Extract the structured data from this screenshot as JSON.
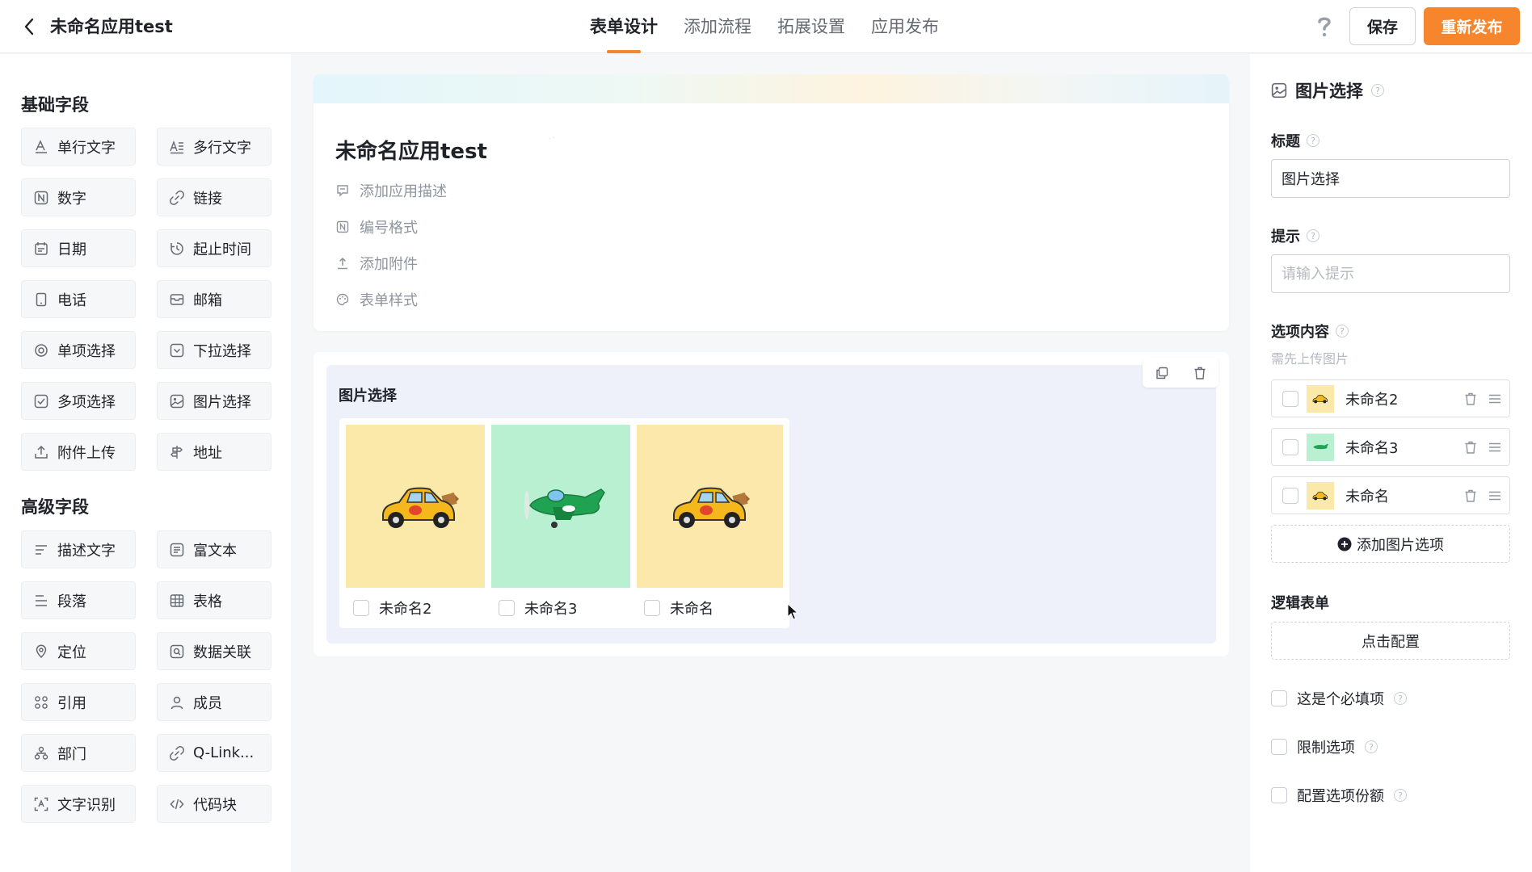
{
  "header": {
    "back_icon": "chevron-left-icon",
    "app_title": "未命名应用test",
    "tabs": [
      {
        "label": "表单设计",
        "active": true
      },
      {
        "label": "添加流程",
        "active": false
      },
      {
        "label": "拓展设置",
        "active": false
      },
      {
        "label": "应用发布",
        "active": false
      }
    ],
    "help_icon": "question-icon",
    "save_label": "保存",
    "publish_label": "重新发布",
    "accent_color": "#f5862e"
  },
  "left_panel": {
    "basic_title": "基础字段",
    "basic_fields": [
      {
        "label": "单行文字",
        "icon": "single-line-text-icon"
      },
      {
        "label": "多行文字",
        "icon": "multi-line-text-icon"
      },
      {
        "label": "数字",
        "icon": "number-icon"
      },
      {
        "label": "链接",
        "icon": "link-icon"
      },
      {
        "label": "日期",
        "icon": "calendar-icon"
      },
      {
        "label": "起止时间",
        "icon": "time-range-icon"
      },
      {
        "label": "电话",
        "icon": "phone-icon"
      },
      {
        "label": "邮箱",
        "icon": "mail-icon"
      },
      {
        "label": "单项选择",
        "icon": "radio-icon"
      },
      {
        "label": "下拉选择",
        "icon": "dropdown-icon"
      },
      {
        "label": "多项选择",
        "icon": "checkbox-icon"
      },
      {
        "label": "图片选择",
        "icon": "image-icon"
      },
      {
        "label": "附件上传",
        "icon": "upload-icon"
      },
      {
        "label": "地址",
        "icon": "location-icon"
      }
    ],
    "advanced_title": "高级字段",
    "advanced_fields": [
      {
        "label": "描述文字",
        "icon": "description-icon"
      },
      {
        "label": "富文本",
        "icon": "rich-text-icon"
      },
      {
        "label": "段落",
        "icon": "paragraph-icon"
      },
      {
        "label": "表格",
        "icon": "table-icon"
      },
      {
        "label": "定位",
        "icon": "pin-icon"
      },
      {
        "label": "数据关联",
        "icon": "data-link-icon"
      },
      {
        "label": "引用",
        "icon": "reference-icon"
      },
      {
        "label": "成员",
        "icon": "user-icon"
      },
      {
        "label": "部门",
        "icon": "org-icon"
      },
      {
        "label": "Q-Link...",
        "icon": "qlink-icon"
      },
      {
        "label": "文字识别",
        "icon": "ocr-icon"
      },
      {
        "label": "代码块",
        "icon": "code-icon"
      }
    ]
  },
  "form": {
    "title": "未命名应用test",
    "options": [
      {
        "label": "添加应用描述",
        "icon": "comment-icon"
      },
      {
        "label": "编号格式",
        "icon": "number-icon"
      },
      {
        "label": "添加附件",
        "icon": "upload-icon"
      },
      {
        "label": "表单样式",
        "icon": "palette-icon"
      }
    ]
  },
  "field_card": {
    "title": "图片选择",
    "copy_icon": "copy-icon",
    "delete_icon": "trash-icon",
    "options": [
      {
        "label": "未命名2",
        "image": "taxi-car",
        "bg": "#fae9a8"
      },
      {
        "label": "未命名3",
        "image": "green-airplane",
        "bg": "#b9f0d2"
      },
      {
        "label": "未命名",
        "image": "taxi-car",
        "bg": "#fbe8aa"
      }
    ]
  },
  "right_panel": {
    "header": "图片选择",
    "header_icon": "image-icon",
    "title_label": "标题",
    "title_value": "图片选择",
    "hint_label": "提示",
    "hint_placeholder": "请输入提示",
    "options_label": "选项内容",
    "options_hint": "需先上传图片",
    "options": [
      {
        "label": "未命名2",
        "image": "taxi-car"
      },
      {
        "label": "未命名3",
        "image": "green-airplane"
      },
      {
        "label": "未命名",
        "image": "taxi-car"
      }
    ],
    "add_option_label": "添加图片选项",
    "logic_label": "逻辑表单",
    "logic_button": "点击配置",
    "checks": [
      {
        "label": "这是个必填项"
      },
      {
        "label": "限制选项"
      },
      {
        "label": "配置选项份额"
      }
    ]
  }
}
